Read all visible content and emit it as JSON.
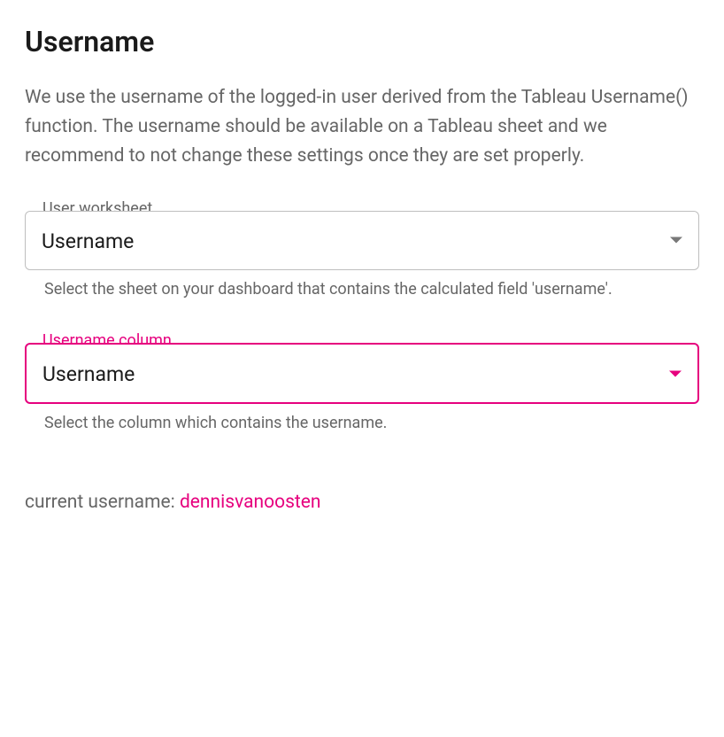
{
  "title": "Username",
  "description": "We use the username of the logged-in user derived from the Tableau Username() function. The username should be available on a Tableau sheet and we recommend to not change these settings once they are set properly.",
  "fields": {
    "worksheet": {
      "label": "User worksheet",
      "value": "Username",
      "helper": "Select the sheet on your dashboard that contains the calculated field 'username'."
    },
    "column": {
      "label": "Username column",
      "value": "Username",
      "helper": "Select the column which contains the username."
    }
  },
  "current_user": {
    "label": "current username: ",
    "value": "dennisvanoosten"
  },
  "colors": {
    "accent": "#e6007e",
    "text_muted": "#666666",
    "border_default": "#bfbfbf"
  }
}
